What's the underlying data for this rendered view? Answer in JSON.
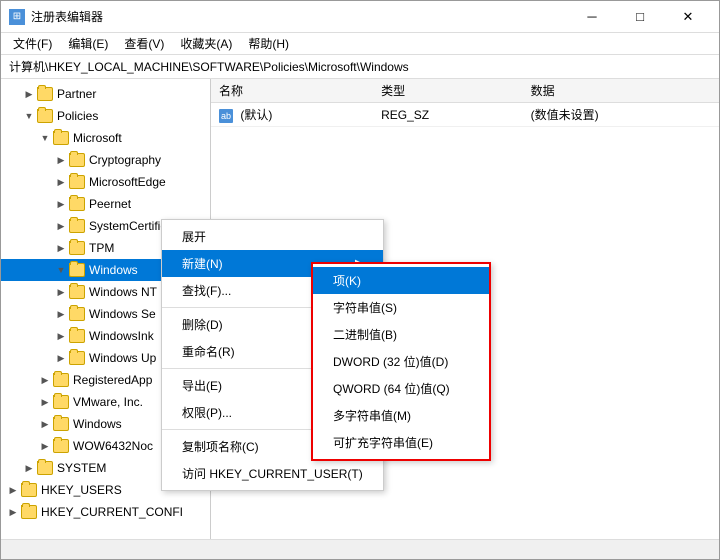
{
  "window": {
    "title": "注册表编辑器",
    "icon": "reg"
  },
  "title_controls": {
    "minimize": "─",
    "maximize": "□",
    "close": "✕"
  },
  "menu_bar": {
    "items": [
      {
        "label": "文件(F)"
      },
      {
        "label": "编辑(E)"
      },
      {
        "label": "查看(V)"
      },
      {
        "label": "收藏夹(A)"
      },
      {
        "label": "帮助(H)"
      }
    ]
  },
  "path_bar": {
    "text": "计算机\\HKEY_LOCAL_MACHINE\\SOFTWARE\\Policies\\Microsoft\\Windows"
  },
  "tree": {
    "items": [
      {
        "label": "Partner",
        "indent": 1,
        "has_toggle": true,
        "toggle": "▶",
        "expanded": false
      },
      {
        "label": "Policies",
        "indent": 1,
        "has_toggle": true,
        "toggle": "▼",
        "expanded": true
      },
      {
        "label": "Microsoft",
        "indent": 2,
        "has_toggle": true,
        "toggle": "▼",
        "expanded": true
      },
      {
        "label": "Cryptography",
        "indent": 3,
        "has_toggle": true,
        "toggle": "▶",
        "expanded": false
      },
      {
        "label": "MicrosoftEdge",
        "indent": 3,
        "has_toggle": true,
        "toggle": "▶",
        "expanded": false
      },
      {
        "label": "Peernet",
        "indent": 3,
        "has_toggle": true,
        "toggle": "▶",
        "expanded": false
      },
      {
        "label": "SystemCertificat",
        "indent": 3,
        "has_toggle": true,
        "toggle": "▶",
        "expanded": false
      },
      {
        "label": "TPM",
        "indent": 3,
        "has_toggle": true,
        "toggle": "▶",
        "expanded": false
      },
      {
        "label": "Windows",
        "indent": 3,
        "has_toggle": true,
        "toggle": "▼",
        "expanded": true,
        "selected": true
      },
      {
        "label": "Windows NT",
        "indent": 3,
        "has_toggle": true,
        "toggle": "▶",
        "expanded": false
      },
      {
        "label": "Windows Se",
        "indent": 3,
        "has_toggle": true,
        "toggle": "▶",
        "expanded": false
      },
      {
        "label": "WindowsInk",
        "indent": 3,
        "has_toggle": true,
        "toggle": "▶",
        "expanded": false
      },
      {
        "label": "Windows Up",
        "indent": 3,
        "has_toggle": true,
        "toggle": "▶",
        "expanded": false
      },
      {
        "label": "RegisteredApp",
        "indent": 2,
        "has_toggle": true,
        "toggle": "▶",
        "expanded": false
      },
      {
        "label": "VMware, Inc.",
        "indent": 2,
        "has_toggle": true,
        "toggle": "▶",
        "expanded": false
      },
      {
        "label": "Windows",
        "indent": 2,
        "has_toggle": true,
        "toggle": "▶",
        "expanded": false
      },
      {
        "label": "WOW6432Noc",
        "indent": 2,
        "has_toggle": true,
        "toggle": "▶",
        "expanded": false
      },
      {
        "label": "SYSTEM",
        "indent": 1,
        "has_toggle": true,
        "toggle": "▶",
        "expanded": false
      },
      {
        "label": "HKEY_USERS",
        "indent": 0,
        "has_toggle": true,
        "toggle": "▶",
        "expanded": false
      },
      {
        "label": "HKEY_CURRENT_CONFI",
        "indent": 0,
        "has_toggle": true,
        "toggle": "▶",
        "expanded": false
      }
    ]
  },
  "registry_table": {
    "columns": [
      "名称",
      "类型",
      "数据"
    ],
    "rows": [
      {
        "name": "(默认)",
        "name_icon": "ab",
        "type": "REG_SZ",
        "data": "(数值未设置)"
      }
    ]
  },
  "context_menu": {
    "items": [
      {
        "label": "展开",
        "type": "item"
      },
      {
        "label": "新建(N)",
        "type": "item",
        "has_arrow": true,
        "active": true
      },
      {
        "label": "查找(F)...",
        "type": "item"
      },
      {
        "separator": true
      },
      {
        "label": "删除(D)",
        "type": "item"
      },
      {
        "label": "重命名(R)",
        "type": "item"
      },
      {
        "separator": true
      },
      {
        "label": "导出(E)",
        "type": "item"
      },
      {
        "label": "权限(P)...",
        "type": "item"
      },
      {
        "separator": true
      },
      {
        "label": "复制项名称(C)",
        "type": "item"
      },
      {
        "label": "访问 HKEY_CURRENT_USER(T)",
        "type": "item"
      }
    ]
  },
  "submenu": {
    "items": [
      {
        "label": "项(K)",
        "highlighted": true
      },
      {
        "label": "字符串值(S)",
        "highlighted": false
      },
      {
        "label": "二进制值(B)",
        "highlighted": false
      },
      {
        "label": "DWORD (32 位)值(D)",
        "highlighted": false
      },
      {
        "label": "QWORD (64 位)值(Q)",
        "highlighted": false
      },
      {
        "label": "多字符串值(M)",
        "highlighted": false
      },
      {
        "label": "可扩充字符串值(E)",
        "highlighted": false
      }
    ]
  },
  "status_bar": {
    "text": ""
  }
}
